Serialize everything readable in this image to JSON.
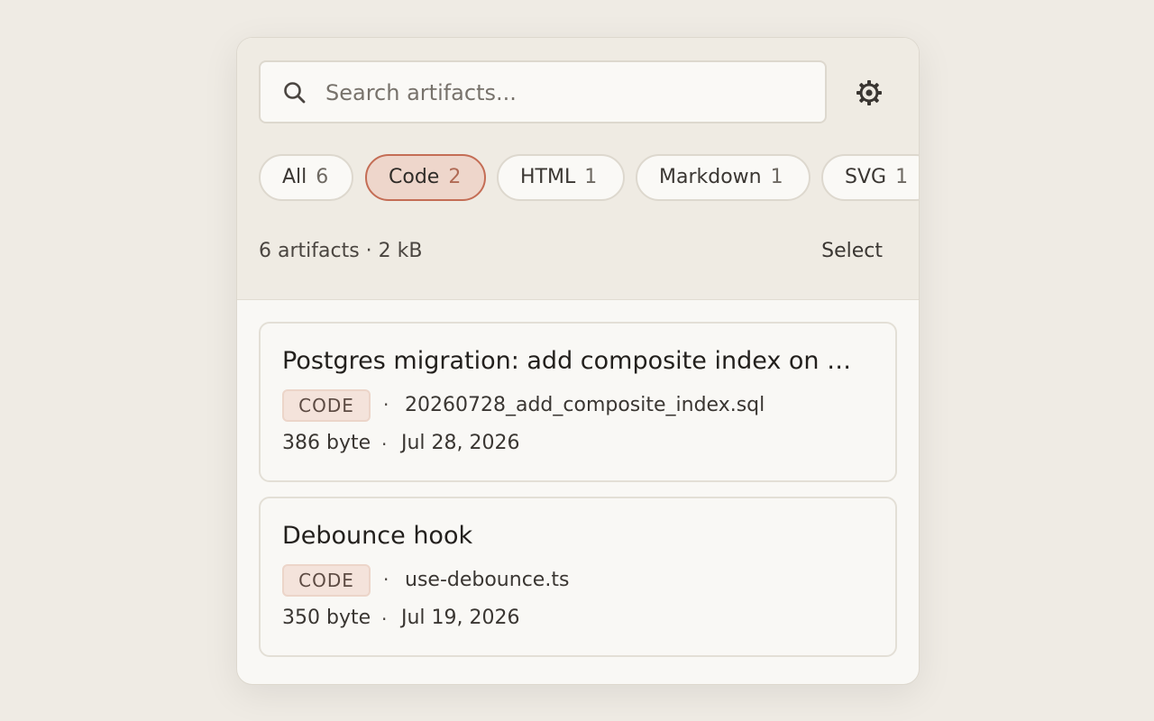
{
  "search": {
    "placeholder": "Search artifacts..."
  },
  "filters": [
    {
      "label": "All",
      "count": "6",
      "active": false
    },
    {
      "label": "Code",
      "count": "2",
      "active": true
    },
    {
      "label": "HTML",
      "count": "1",
      "active": false
    },
    {
      "label": "Markdown",
      "count": "1",
      "active": false
    },
    {
      "label": "SVG",
      "count": "1",
      "active": false
    }
  ],
  "summary": "6 artifacts · 2 kB",
  "select_label": "Select",
  "separator": "·",
  "cards": [
    {
      "title": "Postgres migration: add composite index on orders",
      "badge": "CODE",
      "filename": "20260728_add_composite_index.sql",
      "size": "386 byte",
      "date": "Jul 28, 2026"
    },
    {
      "title": "Debounce hook",
      "badge": "CODE",
      "filename": "use-debounce.ts",
      "size": "350 byte",
      "date": "Jul 19, 2026"
    }
  ],
  "colors": {
    "accent": "#c46d55",
    "accent_bg": "#eed6cb",
    "background": "#efebe4"
  },
  "icons": {
    "search": "search-icon",
    "settings": "gear-icon"
  }
}
